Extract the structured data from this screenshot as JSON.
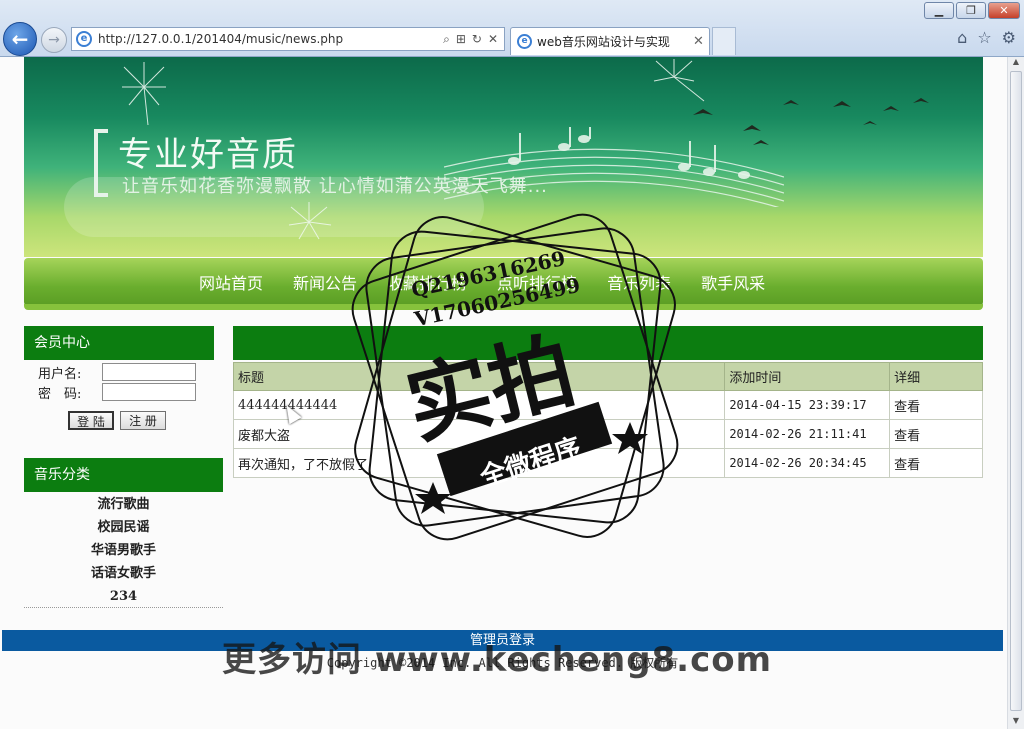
{
  "browser": {
    "url": "http://127.0.0.1/201404/music/news.php",
    "tab_title": "web音乐网站设计与实现",
    "tab_close": "✕",
    "window_minimize": "▁",
    "window_restore": "❐",
    "window_close": "✕",
    "back_glyph": "←",
    "forward_glyph": "→",
    "ie_glyph": "e",
    "search_glyph": "⌕",
    "compat_glyph": "⊞",
    "refresh_glyph": "↻",
    "stop_glyph": "✕",
    "home_glyph": "⌂",
    "favorites_glyph": "☆",
    "tools_glyph": "⚙"
  },
  "banner": {
    "title": "专业好音质",
    "subtitle": "让音乐如花香弥漫飘散  让心情如蒲公英漫天飞舞..."
  },
  "nav": {
    "items": [
      "网站首页",
      "新闻公告",
      "收藏排行榜",
      "点听排行榜",
      "音乐列表",
      "歌手风采"
    ]
  },
  "member": {
    "heading": "会员中心",
    "username_label": "用户名:",
    "password_label": "密　码:",
    "login_button": "登 陆",
    "register_button": "注 册"
  },
  "categories": {
    "heading": "音乐分类",
    "items": [
      "流行歌曲",
      "校园民谣",
      "华语男歌手",
      "话语女歌手",
      "234"
    ]
  },
  "news": {
    "columns": [
      "标题",
      "添加时间",
      "详细"
    ],
    "rows": [
      {
        "title": "444444444444",
        "time": "2014-04-15 23:39:17",
        "detail": "查看"
      },
      {
        "title": "废都大盗",
        "time": "2014-02-26 21:11:41",
        "detail": "查看"
      },
      {
        "title": "再次通知，了不放假了",
        "time": "2014-02-26 20:34:45",
        "detail": "查看"
      }
    ]
  },
  "footer": {
    "admin_link": "管理员登录",
    "copyright": "Copyright ©2014 Inc. All Rights Reserved. 版权所有"
  },
  "watermark": {
    "qq": "Q2196316269",
    "v": "V17060256499",
    "big": "实拍",
    "ribbon": "全微程序",
    "site": "更多访问 www.kecheng8.com"
  },
  "colors": {
    "header_green": "#0c7d10",
    "footer_blue": "#0a5aa0",
    "nav_green": "#6aae2e"
  }
}
